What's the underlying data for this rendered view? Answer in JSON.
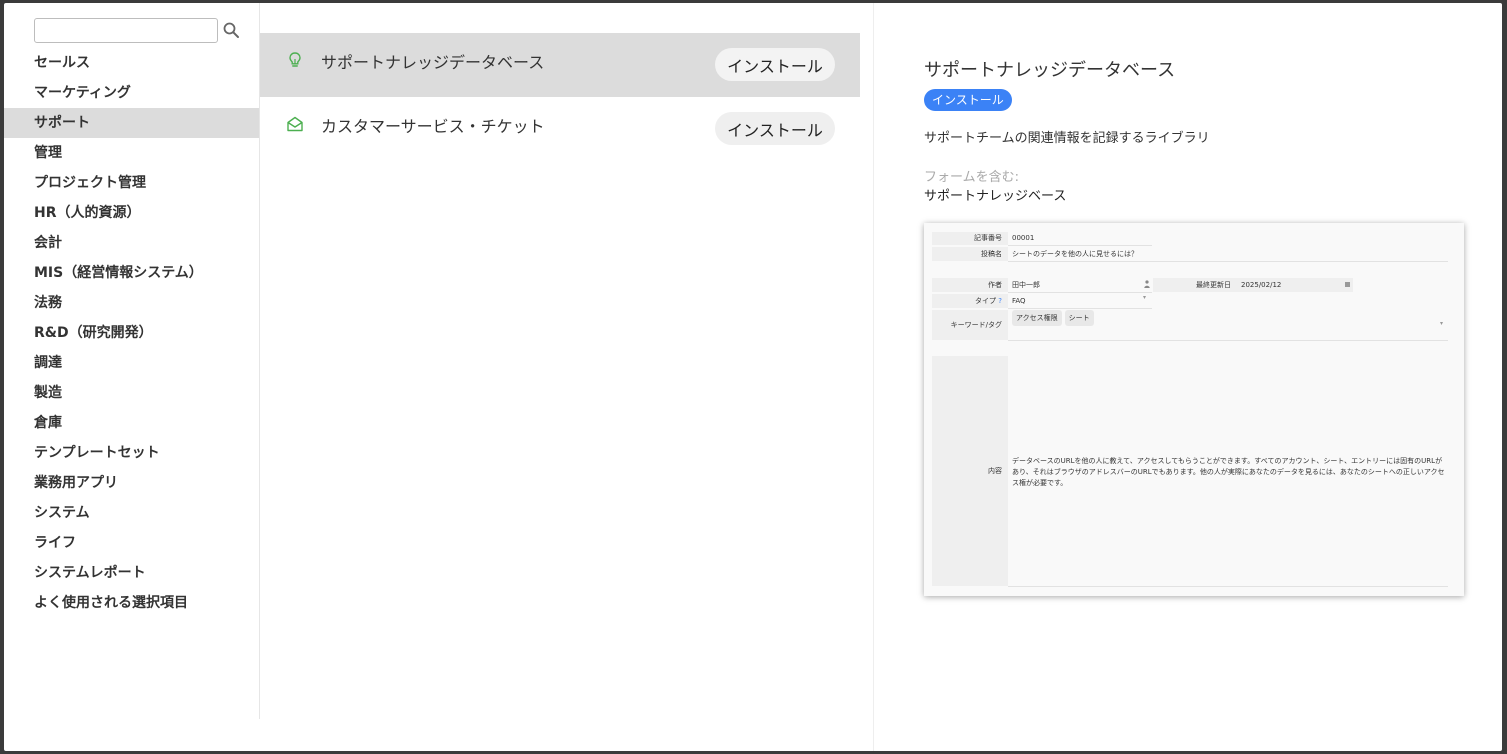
{
  "sidebar": {
    "search": {
      "placeholder": "",
      "value": ""
    },
    "categories": [
      {
        "label": "セールス"
      },
      {
        "label": "マーケティング"
      },
      {
        "label": "サポート"
      },
      {
        "label": "管理"
      },
      {
        "label": "プロジェクト管理"
      },
      {
        "label": "HR（人的資源）"
      },
      {
        "label": "会計"
      },
      {
        "label": "MIS（経営情報システム）"
      },
      {
        "label": "法務"
      },
      {
        "label": "R&D（研究開発）"
      },
      {
        "label": "調達"
      },
      {
        "label": "製造"
      },
      {
        "label": "倉庫"
      },
      {
        "label": "テンプレートセット"
      },
      {
        "label": "業務用アプリ"
      },
      {
        "label": "システム"
      },
      {
        "label": "ライフ"
      },
      {
        "label": "システムレポート"
      },
      {
        "label": "よく使用される選択項目"
      }
    ],
    "active_index": 2
  },
  "templates": [
    {
      "name": "サポートナレッジデータベース",
      "install_label": "インストール",
      "icon": "lightbulb-icon"
    },
    {
      "name": "カスタマーサービス・チケット",
      "install_label": "インストール",
      "icon": "envelope-open-icon"
    }
  ],
  "detail": {
    "title": "サポートナレッジデータベース",
    "install_label": "インストール",
    "description": "サポートチームの関連情報を記録するライブラリ",
    "forms_label": "フォームを含む:",
    "forms_value": "サポートナレッジベース",
    "preview": {
      "article_no_label": "記事番号",
      "article_no": "00001",
      "question_label": "投稿名",
      "question": "シートのデータを他の人に見せるには？",
      "author_label": "作者",
      "author": "田中一郎",
      "updated_label": "最終更新日",
      "updated": "2025/02/12",
      "type_label": "タイプ",
      "type_hint": "?",
      "type": "FAQ",
      "keywords_label": "キーワード/タグ",
      "tags": [
        "アクセス権限",
        "シート"
      ],
      "content_label": "内容",
      "content": "データベースのURLを他の人に教えて、アクセスしてもらうことができます。すべてのアカウント、シート、エントリーには固有のURLがあり、それはブラウザのアドレスバーのURLでもあります。他の人が実際にあなたのデータを見るには、あなたのシートへの正しいアクセス権が必要です。"
    }
  },
  "colors": {
    "accent": "#3b82f6",
    "active_bg": "#dcdcdc",
    "icon_green": "#4caf50"
  }
}
